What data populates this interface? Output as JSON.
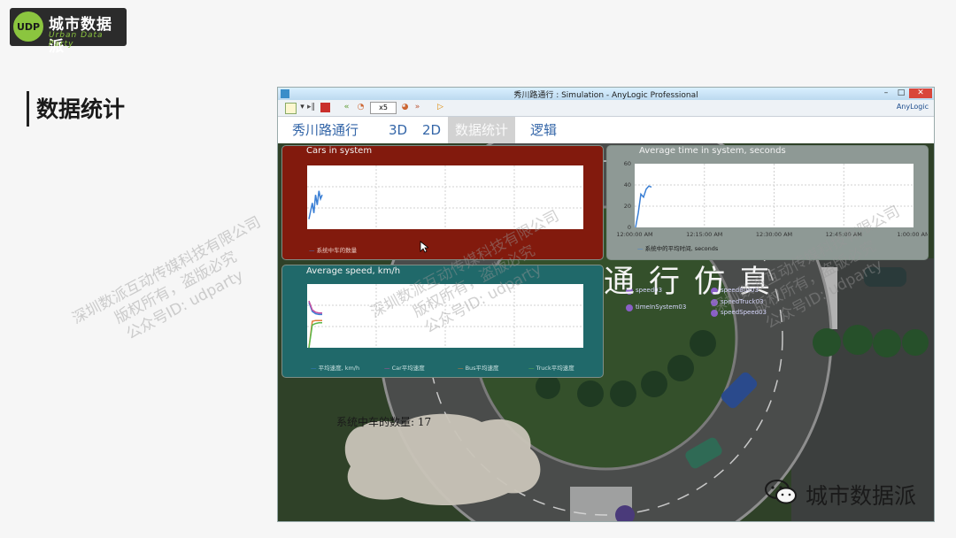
{
  "logo": {
    "mark_text": "UDP",
    "title": "城市数据派",
    "subtitle": "Urban Data Party"
  },
  "page": {
    "heading": "数据统计"
  },
  "watermark": {
    "lines": [
      "深圳数派互动传媒科技有限公司",
      "版权所有，盗版必究",
      "公众号ID: udparty"
    ]
  },
  "window": {
    "title": "秀川路通行 : Simulation - AnyLogic Professional",
    "controls": {
      "minimize": "–",
      "maximize": "□",
      "close": "✕"
    },
    "toolbar": {
      "speed": "x5",
      "brand": "AnyLogic"
    },
    "tabs": [
      {
        "label": "秀川路通行"
      },
      {
        "label": "3D"
      },
      {
        "label": "2D"
      },
      {
        "label": "数据统计",
        "active": true
      },
      {
        "label": "逻辑"
      }
    ]
  },
  "sim": {
    "title": "秀川路通行仿真",
    "car_count_label": "系统中车的数量:",
    "car_count_value": "17",
    "debug_labels": [
      "speed03",
      "speedBus03",
      "timeInSystem03",
      "speedTruck03",
      "speedSpeed03"
    ]
  },
  "chart_data": [
    {
      "type": "line",
      "title": "Cars in system",
      "series": [
        {
          "name": "系统中车的数量",
          "color": "#3a7fd5",
          "values": [
            5,
            9,
            13,
            8,
            17,
            12,
            19,
            15,
            17
          ]
        }
      ],
      "xlabel": "",
      "ylabel": "",
      "grid": true,
      "legend": "bottom-left"
    },
    {
      "type": "line",
      "title": "Average time in system, seconds",
      "x": [
        "12:00:00 AM",
        "12:15:00 AM",
        "12:30:00 AM",
        "12:45:00 AM",
        "1:00:00 AM"
      ],
      "yticks": [
        0,
        20,
        40,
        60
      ],
      "ylim": [
        0,
        60
      ],
      "series": [
        {
          "name": "系统中的平均时间, seconds",
          "color": "#3a7fd5",
          "values": [
            0,
            14,
            33,
            30,
            38,
            41,
            40
          ]
        }
      ],
      "grid": true,
      "legend": "bottom-left"
    },
    {
      "type": "line",
      "title": "Average speed, km/h",
      "series": [
        {
          "name": "平均速度, km/h",
          "color": "#3a7fd5",
          "values": [
            60,
            48,
            45,
            44,
            44
          ]
        },
        {
          "name": "Car平均速度",
          "color": "#c24fa1",
          "values": [
            62,
            50,
            47,
            46,
            46
          ]
        },
        {
          "name": "Bus平均速度",
          "color": "#e07b39",
          "values": [
            0,
            35,
            36,
            36,
            36
          ]
        },
        {
          "name": "Truck平均速度",
          "color": "#5bb84a",
          "values": [
            0,
            30,
            32,
            33,
            33
          ]
        }
      ],
      "grid": true,
      "legend": "bottom"
    }
  ],
  "brand": {
    "name": "城市数据派"
  }
}
